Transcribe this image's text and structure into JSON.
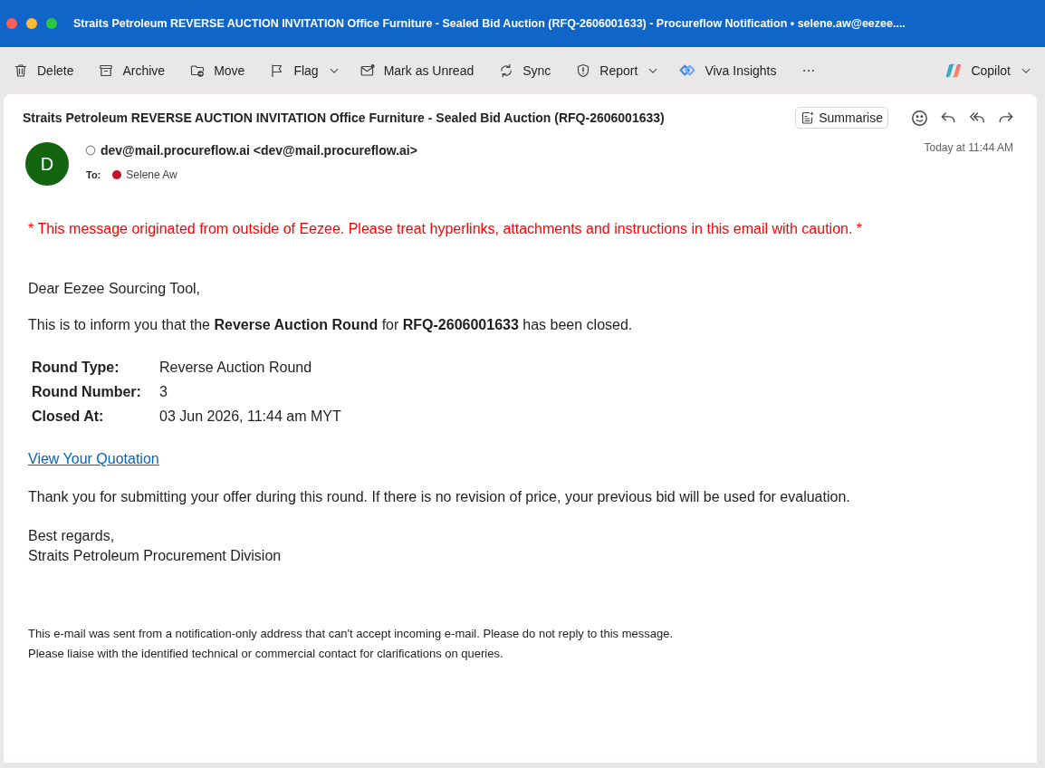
{
  "window": {
    "title": "Straits Petroleum REVERSE AUCTION INVITATION Office Furniture - Sealed Bid Auction (RFQ-2606001633) - Procureflow Notification • selene.aw@eezee...."
  },
  "toolbar": {
    "left": [
      {
        "label": "Delete",
        "dropdown": false
      },
      {
        "label": "Archive",
        "dropdown": false
      },
      {
        "label": "Move",
        "dropdown": false
      },
      {
        "label": "Flag",
        "dropdown": true
      },
      {
        "label": "Mark as Unread",
        "dropdown": false
      },
      {
        "label": "Sync",
        "dropdown": false
      },
      {
        "label": "Report",
        "dropdown": true
      },
      {
        "label": "Viva Insights",
        "dropdown": false
      }
    ],
    "right": [
      {
        "label": "Copilot",
        "dropdown": true
      }
    ]
  },
  "message": {
    "subject": "Straits Petroleum REVERSE AUCTION INVITATION Office Furniture - Sealed Bid Auction (RFQ-2606001633)",
    "summarise": "Summarise",
    "sender": {
      "initial": "D",
      "address": "dev@mail.procureflow.ai <dev@mail.procureflow.ai>"
    },
    "to_label": "To:",
    "recipients": [
      {
        "name": "Selene Aw",
        "color": "#c8102e"
      }
    ],
    "date": "Today at 11:44 AM"
  },
  "body": {
    "warning": "* This message originated from outside of Eezee. Please treat hyperlinks, attachments and instructions in this email with caution. *",
    "greeting": "Dear Eezee Sourcing Tool,",
    "intro": "This is to inform you that the **Reverse Auction Round** for **RFQ-2606001633** has been closed.",
    "details": [
      {
        "label": "Round Type:",
        "value": "Reverse Auction Round"
      },
      {
        "label": "Round Number:",
        "value": "3"
      },
      {
        "label": "Closed At:",
        "value": "03 Jun 2026, 11:44 am MYT"
      }
    ],
    "link": "View Your Quotation",
    "thanks": "Thank you for submitting your offer during this round. If there is no revision of price, your previous bid will be used for evaluation.",
    "closing": "Best regards,",
    "signature": "Straits Petroleum Procurement Division",
    "footer": [
      "This e-mail was sent from a notification-only address that can't accept incoming e-mail. Please do not reply to this message.",
      "Please liaise with the identified technical or commercial contact for clarifications on queries."
    ]
  }
}
